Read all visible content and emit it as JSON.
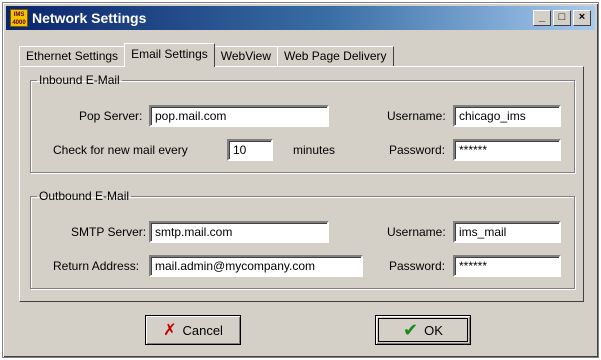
{
  "window": {
    "icon_text": "IMS 4000",
    "title": "Network Settings",
    "minimize": "_",
    "maximize": "□",
    "close": "×"
  },
  "tabs": [
    {
      "label": "Ethernet Settings"
    },
    {
      "label": "Email Settings"
    },
    {
      "label": "WebView"
    },
    {
      "label": "Web Page Delivery"
    }
  ],
  "inbound": {
    "legend": "Inbound E-Mail",
    "pop_label": "Pop Server:",
    "pop_value": "pop.mail.com",
    "check_label": "Check for new mail every",
    "check_value": "10",
    "check_unit": "minutes",
    "username_label": "Username:",
    "username_value": "chicago_ims",
    "password_label": "Password:",
    "password_value": "******"
  },
  "outbound": {
    "legend": "Outbound E-Mail",
    "smtp_label": "SMTP Server:",
    "smtp_value": "smtp.mail.com",
    "return_label": "Return Address:",
    "return_value": "mail.admin@mycompany.com",
    "username_label": "Username:",
    "username_value": "ims_mail",
    "password_label": "Password:",
    "password_value": "******"
  },
  "buttons": {
    "cancel_icon": "✗",
    "cancel_label": "Cancel",
    "ok_icon": "✔",
    "ok_label": "OK"
  }
}
